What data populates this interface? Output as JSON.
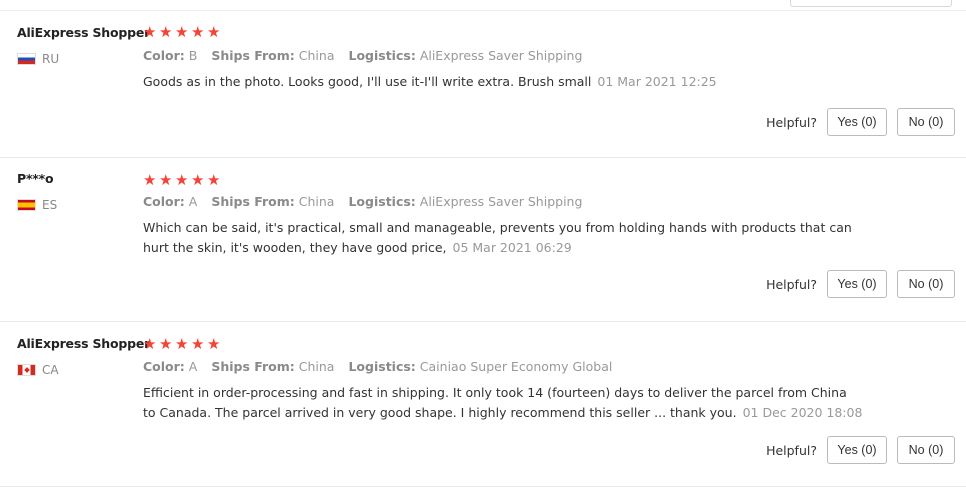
{
  "reviews": [
    {
      "user": "AliExpress Shopper",
      "country": "RU",
      "flag": "ru",
      "rating": 5,
      "color_label": "Color:",
      "color_value": "B",
      "ships_label": "Ships From:",
      "ships_value": "China",
      "logistics_label": "Logistics:",
      "logistics_value": "AliExpress Saver Shipping",
      "text": "Goods as in the photo. Looks good, I'll use it-I'll write extra. Brush small",
      "date": "01 Mar 2021 12:25",
      "helpful_label": "Helpful?",
      "yes_label": "Yes (0)",
      "no_label": "No (0)"
    },
    {
      "user": "P***o",
      "country": "ES",
      "flag": "es",
      "rating": 5,
      "color_label": "Color:",
      "color_value": "A",
      "ships_label": "Ships From:",
      "ships_value": "China",
      "logistics_label": "Logistics:",
      "logistics_value": "AliExpress Saver Shipping",
      "text": "Which can be said, it's practical, small and manageable, prevents you from holding hands with products that can hurt the skin, it's wooden, they have good price,",
      "date": "05 Mar 2021 06:29",
      "helpful_label": "Helpful?",
      "yes_label": "Yes (0)",
      "no_label": "No (0)"
    },
    {
      "user": "AliExpress Shopper",
      "country": "CA",
      "flag": "ca",
      "rating": 5,
      "color_label": "Color:",
      "color_value": "A",
      "ships_label": "Ships From:",
      "ships_value": "China",
      "logistics_label": "Logistics:",
      "logistics_value": "Cainiao Super Economy Global",
      "text": "Efficient in order-processing and fast in shipping. It only took 14 (fourteen) days to deliver the parcel from China to Canada. The parcel arrived in very good shape. I highly recommend this seller ... thank you.",
      "date": "01 Dec 2020 18:08",
      "helpful_label": "Helpful?",
      "yes_label": "Yes (0)",
      "no_label": "No (0)"
    }
  ],
  "colors": {
    "star": "#f44336",
    "divider": "#e8e8e8",
    "meta_text": "#999999"
  }
}
